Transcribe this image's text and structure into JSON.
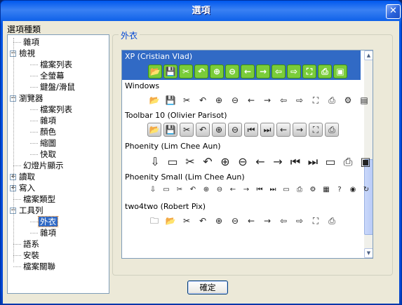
{
  "window": {
    "title": "選項",
    "close_glyph": "✕"
  },
  "category_label": "選項種類",
  "tree": [
    {
      "label": "雜項",
      "level": 1,
      "expander": ""
    },
    {
      "label": "檢視",
      "level": 0,
      "expander": "−"
    },
    {
      "label": "檔案列表",
      "level": 2,
      "expander": ""
    },
    {
      "label": "全螢幕",
      "level": 2,
      "expander": ""
    },
    {
      "label": "鍵盤/滑鼠",
      "level": 2,
      "expander": ""
    },
    {
      "label": "瀏覽器",
      "level": 0,
      "expander": "−"
    },
    {
      "label": "檔案列表",
      "level": 2,
      "expander": ""
    },
    {
      "label": "雜項",
      "level": 2,
      "expander": ""
    },
    {
      "label": "顏色",
      "level": 2,
      "expander": ""
    },
    {
      "label": "縮圖",
      "level": 2,
      "expander": ""
    },
    {
      "label": "快取",
      "level": 2,
      "expander": ""
    },
    {
      "label": "幻燈片顯示",
      "level": 1,
      "expander": ""
    },
    {
      "label": "讀取",
      "level": 0,
      "expander": "+"
    },
    {
      "label": "寫入",
      "level": 0,
      "expander": "+"
    },
    {
      "label": "檔案類型",
      "level": 1,
      "expander": ""
    },
    {
      "label": "工具列",
      "level": 0,
      "expander": "−"
    },
    {
      "label": "外衣",
      "level": 2,
      "expander": "",
      "selected": true
    },
    {
      "label": "雜項",
      "level": 2,
      "expander": ""
    },
    {
      "label": "語系",
      "level": 1,
      "expander": ""
    },
    {
      "label": "安裝",
      "level": 1,
      "expander": ""
    },
    {
      "label": "檔案關聯",
      "level": 1,
      "expander": ""
    }
  ],
  "group_label": "外衣",
  "skins": [
    {
      "name": "XP (Cristian Vlad)",
      "selected": true,
      "style": "green",
      "icons": [
        "open-icon",
        "save-icon",
        "cut-icon",
        "undo-icon",
        "zoom-in-icon",
        "zoom-out-icon",
        "back-icon",
        "forward-icon",
        "prev-folder-icon",
        "next-folder-icon",
        "fullscreen-icon",
        "print-icon",
        "extra-icon"
      ]
    },
    {
      "name": "Windows",
      "selected": false,
      "style": "plain",
      "icons": [
        "open-icon",
        "save-icon",
        "cut-icon",
        "undo-icon",
        "zoom-in-icon",
        "zoom-out-icon",
        "back-icon",
        "forward-icon",
        "prev-folder-icon",
        "next-folder-icon",
        "fullscreen-icon",
        "print-icon",
        "settings-icon",
        "slideshow-icon",
        "film-icon"
      ]
    },
    {
      "name": "Toolbar 10 (Olivier Parisot)",
      "selected": false,
      "style": "bevel",
      "icons": [
        "open-icon",
        "save-icon",
        "cut-icon",
        "undo-icon",
        "zoom-in-icon",
        "zoom-out-icon",
        "prev-icon",
        "next-icon",
        "back-icon",
        "forward-icon",
        "fullscreen-icon",
        "print-icon"
      ]
    },
    {
      "name": "Phoenity (Lim Chee Aun)",
      "selected": false,
      "style": "big",
      "icons": [
        "download-icon",
        "window-icon",
        "cut-icon",
        "undo-icon",
        "zoom-in-icon",
        "zoom-out-icon",
        "back-icon",
        "forward-icon",
        "prev-icon",
        "next-icon",
        "window-icon",
        "print-icon",
        "extra-icon"
      ]
    },
    {
      "name": "Phoenity Small (Lim Chee Aun)",
      "selected": false,
      "style": "tiny",
      "icons": [
        "download-icon",
        "window-icon",
        "cut-icon",
        "undo-icon",
        "zoom-in-icon",
        "zoom-out-icon",
        "back-icon",
        "forward-icon",
        "prev-icon",
        "next-icon",
        "window-icon",
        "print-icon",
        "settings-icon",
        "film-icon",
        "help-icon",
        "camera-icon",
        "refresh-icon",
        "settings-icon",
        "extra-icon"
      ]
    },
    {
      "name": "two4two (Robert Pix)",
      "selected": false,
      "style": "plain",
      "icons": [
        "folder-icon",
        "open-icon",
        "cut-icon",
        "undo-icon",
        "zoom-in-icon",
        "zoom-out-icon",
        "back-icon",
        "forward-icon",
        "prev-folder-icon",
        "next-folder-icon",
        "fullscreen-icon",
        "print-icon"
      ]
    }
  ],
  "glyphs": {
    "open-icon": "📂",
    "save-icon": "💾",
    "cut-icon": "✂",
    "undo-icon": "↶",
    "zoom-in-icon": "⊕",
    "zoom-out-icon": "⊖",
    "back-icon": "←",
    "forward-icon": "→",
    "prev-folder-icon": "⇦",
    "next-folder-icon": "⇨",
    "fullscreen-icon": "⛶",
    "print-icon": "⎙",
    "extra-icon": "▣",
    "settings-icon": "⚙",
    "slideshow-icon": "▤",
    "film-icon": "▦",
    "prev-icon": "⏮",
    "next-icon": "⏭",
    "download-icon": "⇩",
    "window-icon": "▭",
    "help-icon": "?",
    "camera-icon": "◉",
    "refresh-icon": "↻",
    "folder-icon": "🗀"
  },
  "colors": {
    "selection": "#316ac5",
    "accent_label": "#0046d5",
    "tree_border": "#7f9db9"
  },
  "ok_button": "確定"
}
